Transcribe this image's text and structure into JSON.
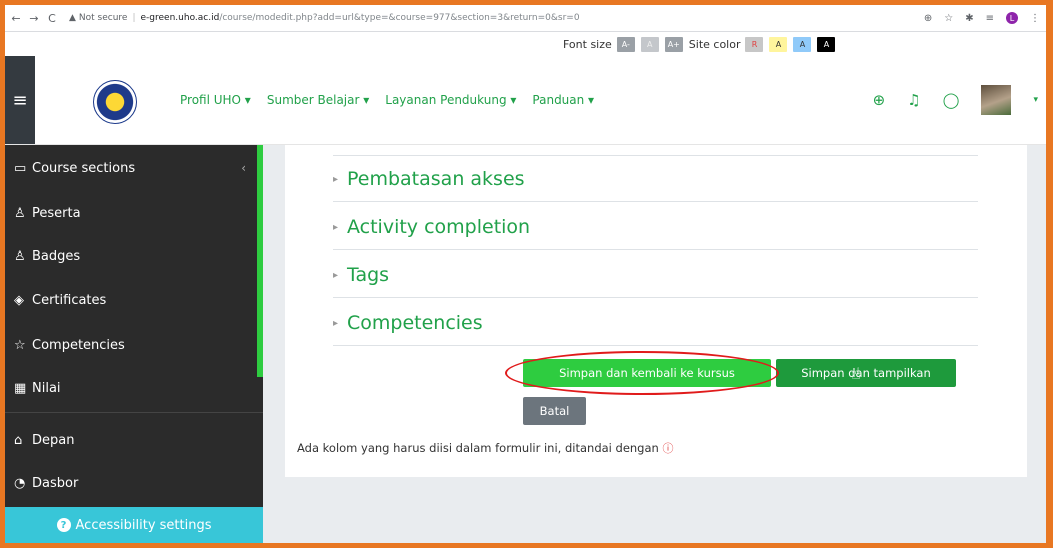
{
  "browser": {
    "not_secure": "Not secure",
    "host": "e-green.uho.ac.id",
    "path": "/course/modedit.php?add=url&type=&course=977&section=3&return=0&sr=0",
    "profile_initial": "L"
  },
  "accessibility_bar": {
    "font_size_label": "Font size",
    "font_buttons": [
      "A-",
      "A",
      "A+"
    ],
    "site_color_label": "Site color",
    "color_buttons": [
      "R",
      "A",
      "A",
      "A"
    ]
  },
  "navbar": {
    "menu": [
      "Profil UHO ▾",
      "Sumber Belajar ▾",
      "Layanan Pendukung ▾",
      "Panduan ▾"
    ]
  },
  "sidebar": {
    "items": [
      {
        "icon": "folder-icon",
        "label": "Course sections"
      },
      {
        "icon": "people-icon",
        "label": "Peserta"
      },
      {
        "icon": "badge-icon",
        "label": "Badges"
      },
      {
        "icon": "certificate-icon",
        "label": "Certificates"
      },
      {
        "icon": "star-icon",
        "label": "Competencies"
      },
      {
        "icon": "grades-icon",
        "label": "Nilai"
      },
      {
        "icon": "home-icon",
        "label": "Depan"
      },
      {
        "icon": "dashboard-icon",
        "label": "Dasbor"
      }
    ],
    "accessibility_settings": "Accessibility settings"
  },
  "form": {
    "sections": [
      "Pembatasan akses",
      "Activity completion",
      "Tags",
      "Competencies"
    ],
    "save_return_label": "Simpan dan kembali ke kursus",
    "save_display_label": "Simpan dan tampilkan",
    "cancel_label": "Batal",
    "required_note": "Ada kolom yang harus diisi dalam formulir ini, ditandai dengan"
  },
  "colors": {
    "accent_green": "#2ecc40",
    "dark_green": "#1e9a3c",
    "sidebar_bg": "#2b2b2b",
    "highlight_red": "#e01b1b",
    "frame_orange": "#e87722"
  }
}
